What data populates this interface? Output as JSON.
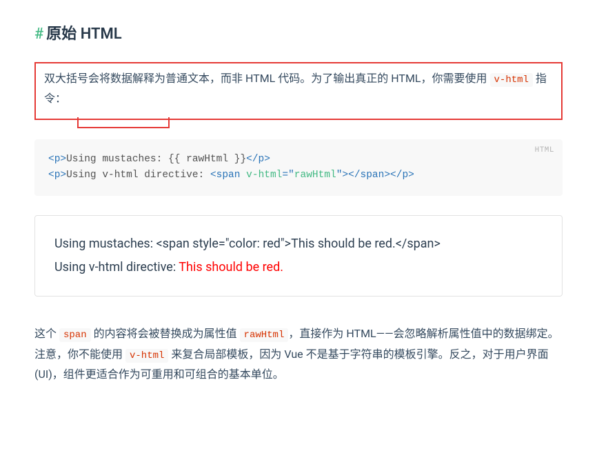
{
  "heading": {
    "hash": "#",
    "text": "原始 HTML"
  },
  "intro": {
    "part1": "双大括号会将数据解释为普通文本，而非 HTML 代码。为了输出真正的 HTML，你需要使用 ",
    "code": "v-html",
    "part2": " 指令："
  },
  "codeblock": {
    "lang": "HTML",
    "line1": {
      "open1": "<p>",
      "txt": "Using mustaches: {{ rawHtml }}",
      "close1": "</p>"
    },
    "line2": {
      "open1": "<p>",
      "txt1": "Using v-html directive: ",
      "open2": "<span",
      "spc": " ",
      "attr": "v-html",
      "eq": "=",
      "q1": "\"",
      "str": "rawHtml",
      "q2": "\"",
      "close2": ">",
      "close3": "</span>",
      "close4": "</p>"
    }
  },
  "output": {
    "line1a": "Using mustaches: ",
    "line1b": "<span style=\"color: red\">This should be red.</span>",
    "line2a": "Using v-html directive: ",
    "line2b": "This should be red."
  },
  "para2": {
    "t1": "这个 ",
    "c1": "span",
    "t2": " 的内容将会被替换成为属性值 ",
    "c2": "rawHtml",
    "t3": "，直接作为 HTML——会忽略解析属性值中的数据绑定。注意，你不能使用 ",
    "c3": "v-html",
    "t4": " 来复合局部模板，因为 Vue 不是基于字符串的模板引擎。反之，对于用户界面 (UI)，组件更适合作为可重用和可组合的基本单位。"
  }
}
